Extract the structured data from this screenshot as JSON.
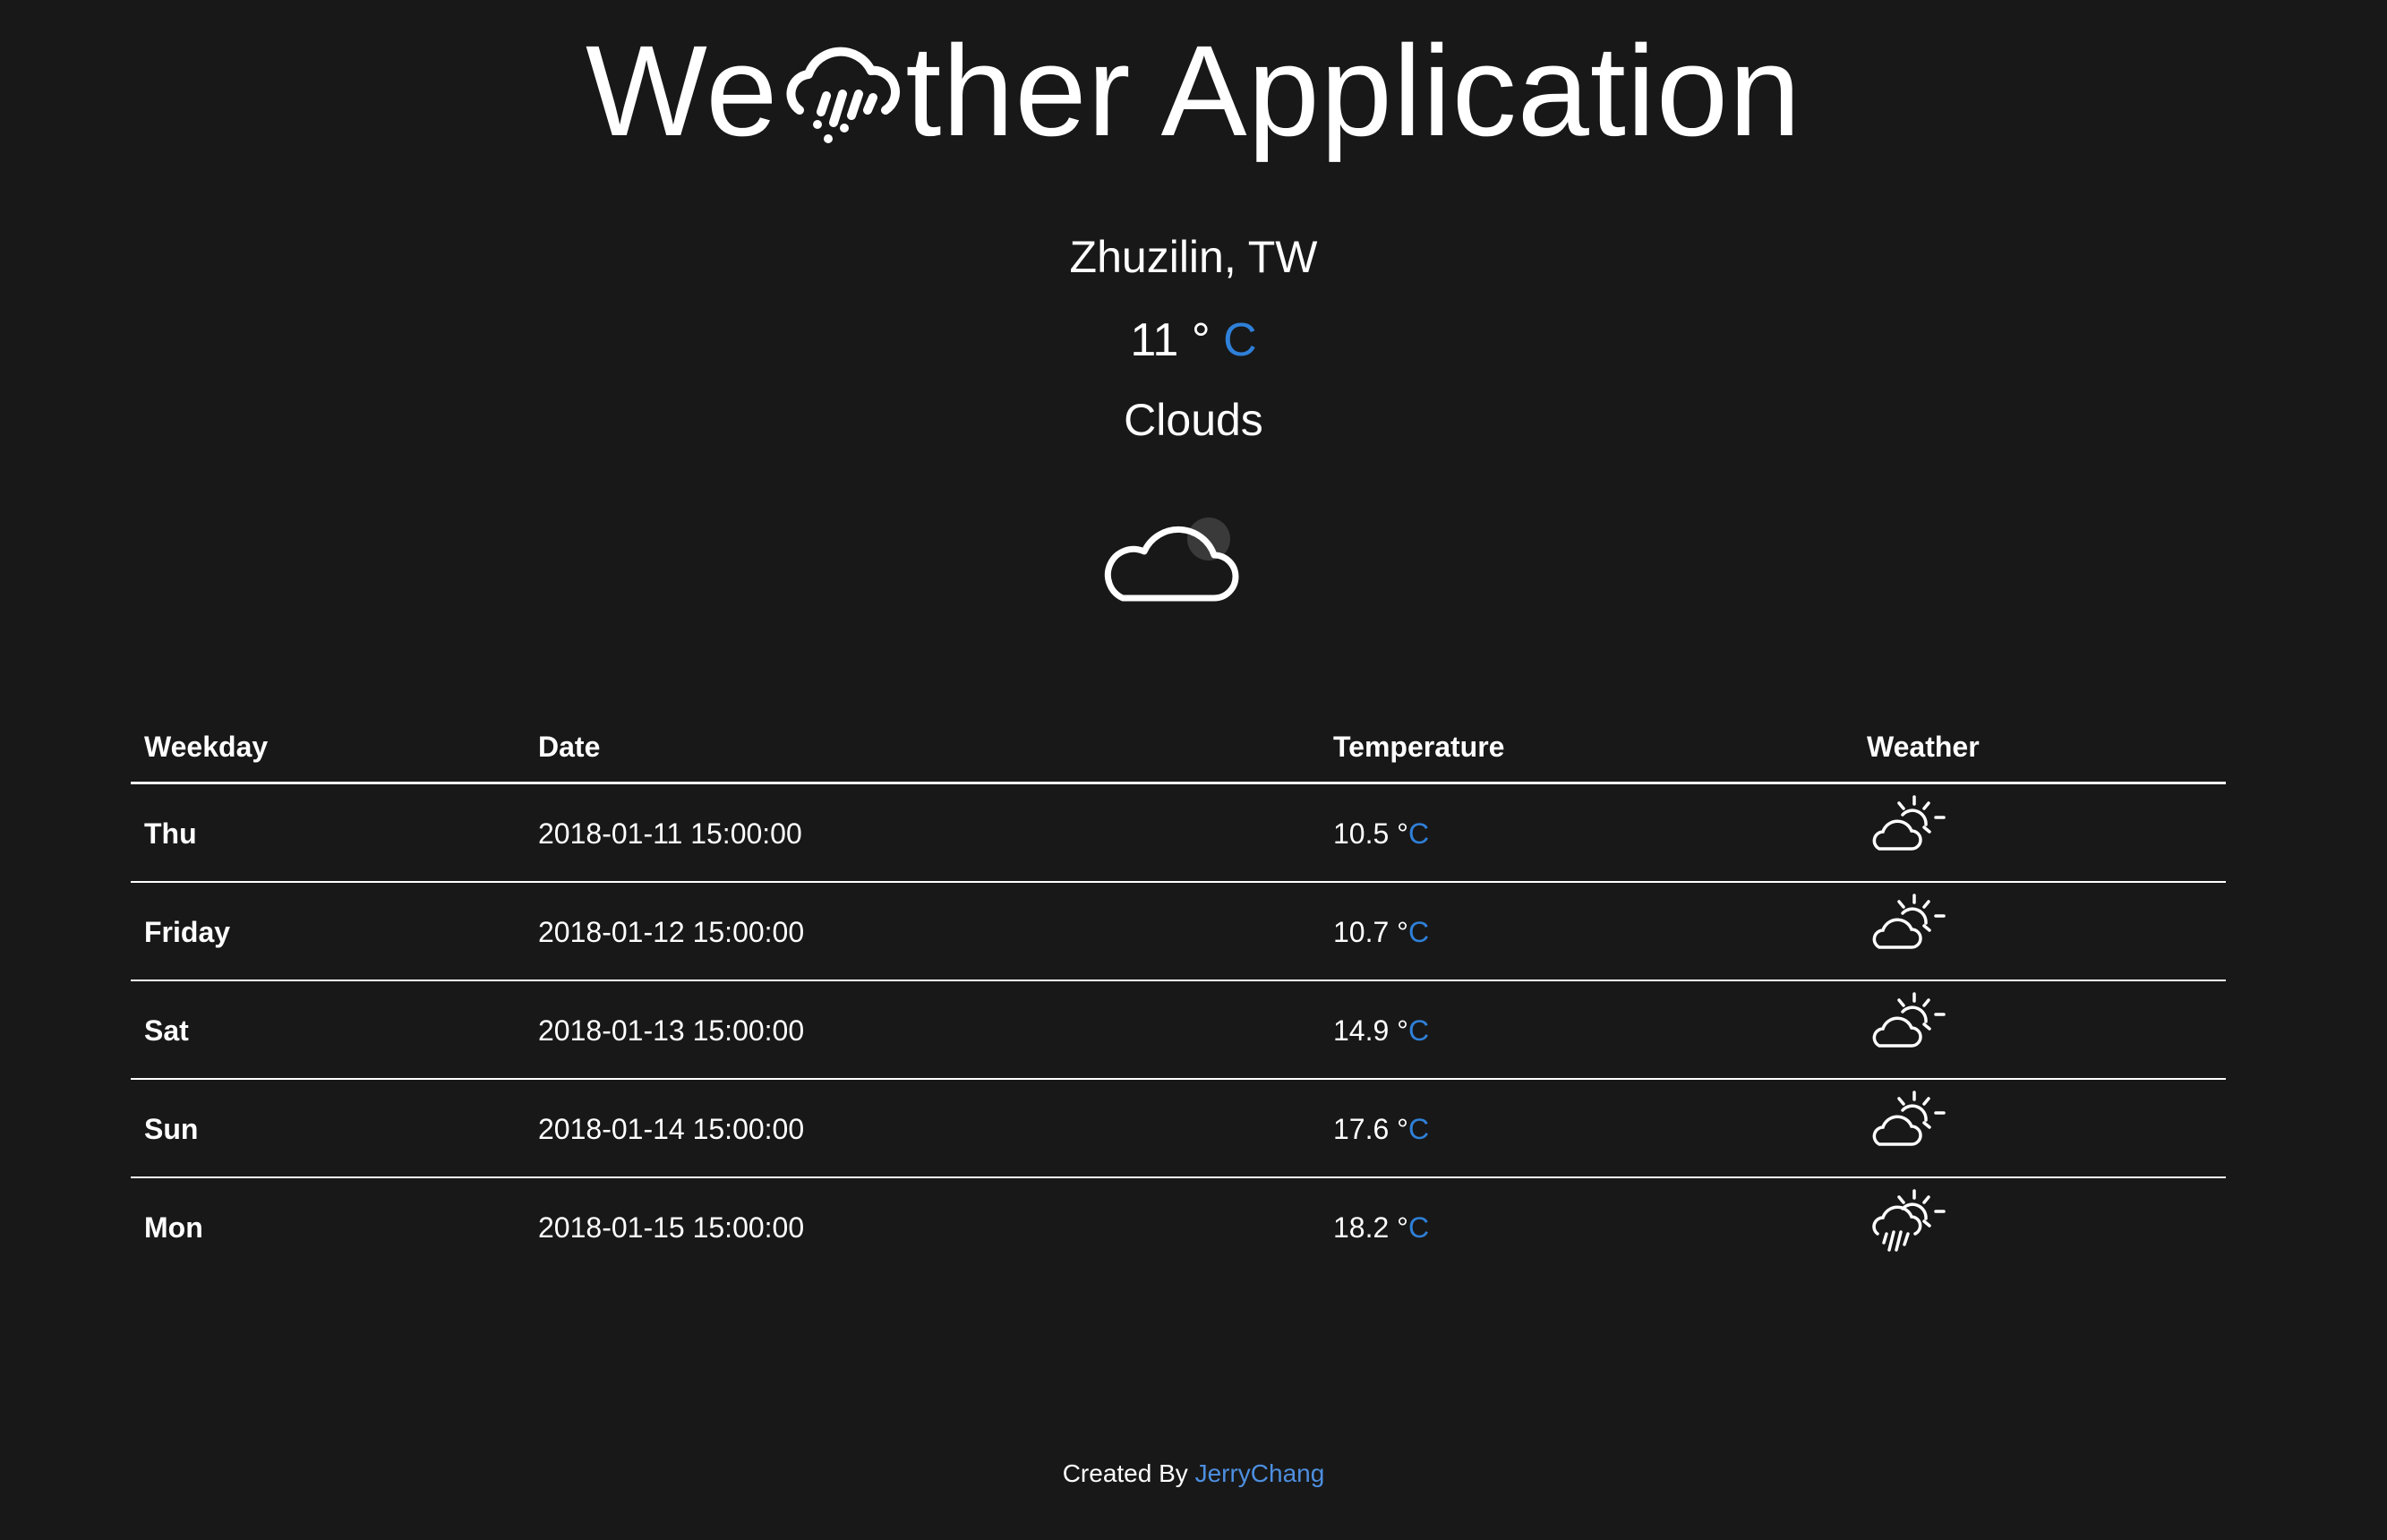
{
  "app": {
    "title_start": "We",
    "title_end": "ther Application",
    "logo_icon": "cloud-rain-icon"
  },
  "current": {
    "city": "Zhuzilin, TW",
    "temperature": "11",
    "degree_symbol": "°",
    "unit": "C",
    "condition": "Clouds",
    "icon": "cloud-icon"
  },
  "forecast": {
    "headers": {
      "weekday": "Weekday",
      "date": "Date",
      "temperature": "Temperature",
      "weather": "Weather"
    },
    "rows": [
      {
        "weekday": "Thu",
        "date": "2018-01-11 15:00:00",
        "temp": "10.5",
        "degree": "°",
        "unit": "C",
        "icon": "partly-cloudy-day-icon"
      },
      {
        "weekday": "Friday",
        "date": "2018-01-12 15:00:00",
        "temp": "10.7",
        "degree": "°",
        "unit": "C",
        "icon": "partly-cloudy-day-icon"
      },
      {
        "weekday": "Sat",
        "date": "2018-01-13 15:00:00",
        "temp": "14.9",
        "degree": "°",
        "unit": "C",
        "icon": "partly-cloudy-day-icon"
      },
      {
        "weekday": "Sun",
        "date": "2018-01-14 15:00:00",
        "temp": "17.6",
        "degree": "°",
        "unit": "C",
        "icon": "partly-cloudy-day-icon"
      },
      {
        "weekday": "Mon",
        "date": "2018-01-15 15:00:00",
        "temp": "18.2",
        "degree": "°",
        "unit": "C",
        "icon": "day-rain-icon"
      }
    ]
  },
  "footer": {
    "prefix": "Created By",
    "author": "JerryChang"
  },
  "colors": {
    "background": "#181818",
    "text": "#ffffff",
    "accent": "#2f80d8",
    "link": "#4d8fe0"
  }
}
